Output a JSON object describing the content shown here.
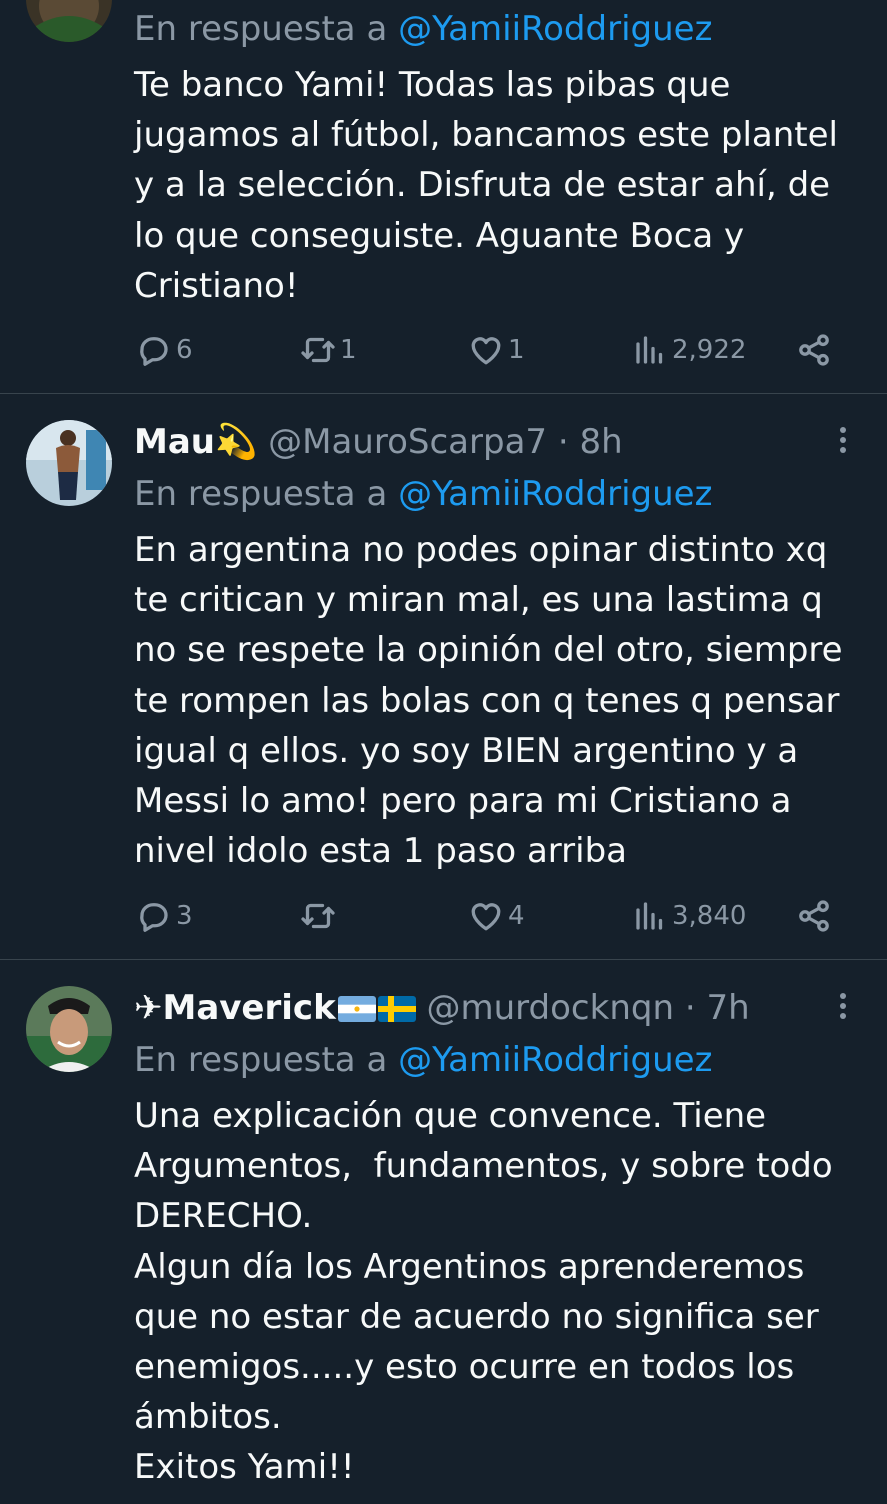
{
  "tweets": [
    {
      "reply_prefix": "En respuesta a ",
      "reply_handle": "@YamiiRoddriguez",
      "body_lines": [
        "Te banco Yami! Todas las pibas que",
        "jugamos al fútbol, bancamos este plantel",
        "y a la selección. Disfruta de estar ahí, de",
        "lo que conseguiste. Aguante Boca y",
        "Cristiano!"
      ],
      "stats": {
        "replies": "6",
        "retweets": "1",
        "likes": "1",
        "views": "2,922"
      }
    },
    {
      "display_name": "Mau💫",
      "handle": "@MauroScarpa7",
      "separator": "·",
      "time": "8h",
      "reply_prefix": "En respuesta a ",
      "reply_handle": "@YamiiRoddriguez",
      "body_lines": [
        "En argentina no podes opinar distinto xq",
        "te critican y miran mal, es una lastima q",
        "no se respete la opinión del otro, siempre",
        "te rompen las bolas con q tenes q pensar",
        "igual q ellos. yo soy BIEN argentino y a",
        "Messi lo amo! pero para mi Cristiano a",
        "nivel idolo esta 1 paso arriba"
      ],
      "stats": {
        "replies": "3",
        "retweets": "",
        "likes": "4",
        "views": "3,840"
      }
    },
    {
      "display_name": "✈Maverick",
      "flags": [
        "argentina-flag",
        "sweden-flag"
      ],
      "handle": "@murdocknqn",
      "separator": "·",
      "time": "7h",
      "reply_prefix": "En respuesta a ",
      "reply_handle": "@YamiiRoddriguez",
      "body_lines": [
        "Una explicación que convence. Tiene",
        "Argumentos,  fundamentos, y sobre todo",
        "DERECHO.",
        "Algun día los Argentinos aprenderemos",
        "que no estar de acuerdo no significa ser",
        "enemigos.....y esto ocurre en todos los",
        "ámbitos.",
        "Exitos Yami!!"
      ]
    }
  ],
  "colors": {
    "background": "#15202b",
    "text": "#f7f9f9",
    "secondary": "#8b98a5",
    "link": "#1d9bf0",
    "divider": "#38444d"
  },
  "icons": [
    "reply-icon",
    "retweet-icon",
    "like-icon",
    "views-icon",
    "share-icon",
    "more-options-icon"
  ]
}
